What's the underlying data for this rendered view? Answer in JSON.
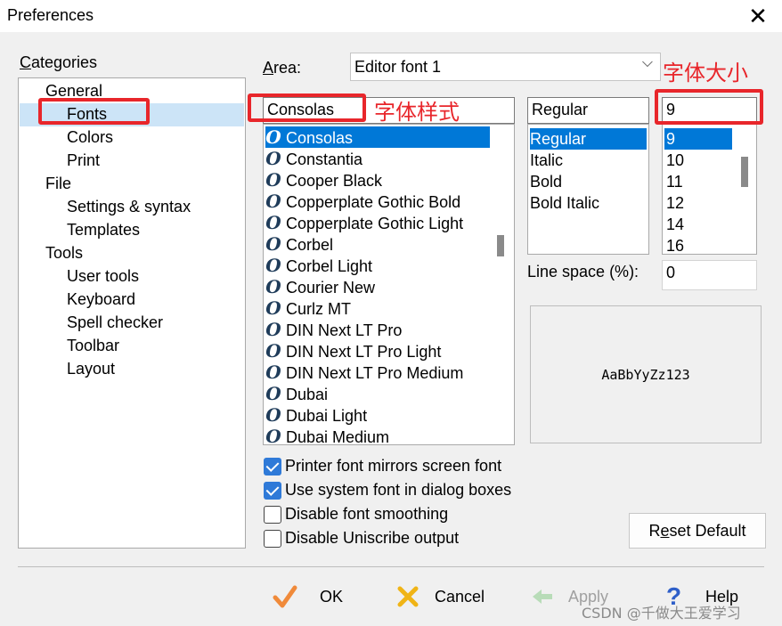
{
  "window": {
    "title": "Preferences"
  },
  "categories": {
    "label": "Categories",
    "tree": [
      {
        "label": "General"
      },
      {
        "label": "Fonts",
        "selected": true
      },
      {
        "label": "Colors"
      },
      {
        "label": "Print"
      },
      {
        "label": "File"
      },
      {
        "label": "Settings & syntax"
      },
      {
        "label": "Templates"
      },
      {
        "label": "Tools"
      },
      {
        "label": "User tools"
      },
      {
        "label": "Keyboard"
      },
      {
        "label": "Spell checker"
      },
      {
        "label": "Toolbar"
      },
      {
        "label": "Layout"
      }
    ]
  },
  "area": {
    "label": "Area:",
    "value": "Editor font 1"
  },
  "font": {
    "name_value": "Consolas",
    "list": [
      "Consolas",
      "Constantia",
      "Cooper Black",
      "Copperplate Gothic Bold",
      "Copperplate Gothic Light",
      "Corbel",
      "Corbel Light",
      "Courier New",
      "Curlz MT",
      "DIN Next LT Pro",
      "DIN Next LT Pro Light",
      "DIN Next LT Pro Medium",
      "Dubai",
      "Dubai Light",
      "Dubai Medium"
    ],
    "selected": "Consolas",
    "style_value": "Regular",
    "styles": [
      "Regular",
      "Italic",
      "Bold",
      "Bold Italic"
    ],
    "size_value": "9",
    "sizes": [
      "9",
      "10",
      "11",
      "12",
      "14",
      "16"
    ]
  },
  "line_space": {
    "label": "Line space (%):",
    "value": "0"
  },
  "preview": {
    "text": "AaBbYyZz123"
  },
  "options": [
    {
      "label": "Printer font mirrors screen font",
      "checked": true
    },
    {
      "label": "Use system font in dialog boxes",
      "checked": true
    },
    {
      "label": "Disable font smoothing",
      "checked": false
    },
    {
      "label": "Disable Uniscribe output",
      "checked": false
    }
  ],
  "buttons": {
    "reset_default": "Reset Default",
    "ok": "OK",
    "cancel": "Cancel",
    "apply": "Apply",
    "help": "Help"
  },
  "annotations": {
    "font_style": "字体样式",
    "font_size": "字体大小"
  },
  "watermark": "CSDN @千做大王爱学习",
  "colors": {
    "accent": "#0078d7",
    "annotation": "#e8262b",
    "checkbox": "#2f7ad8"
  }
}
